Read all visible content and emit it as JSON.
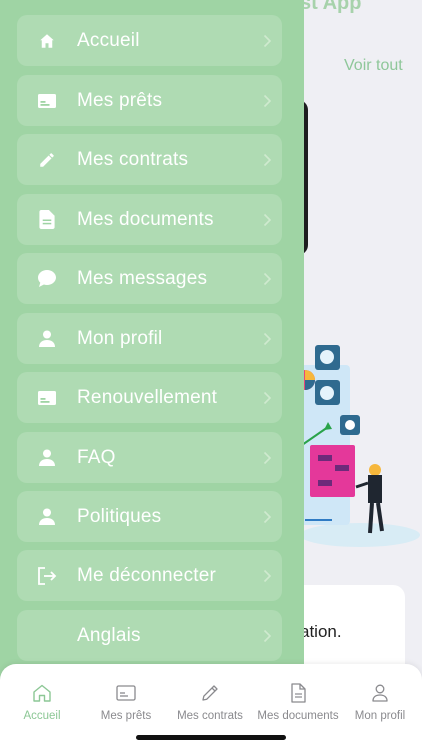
{
  "background": {
    "title_fragment": "st App",
    "voir_tout": "Voir tout",
    "panel_text": "ation."
  },
  "menu": {
    "items": [
      {
        "label": "Accueil",
        "icon": "home-icon"
      },
      {
        "label": "Mes prêts",
        "icon": "card-icon"
      },
      {
        "label": "Mes contrats",
        "icon": "pencil-icon"
      },
      {
        "label": "Mes documents",
        "icon": "document-icon"
      },
      {
        "label": "Mes messages",
        "icon": "chat-bubble-icon"
      },
      {
        "label": "Mon profil",
        "icon": "person-icon"
      },
      {
        "label": "Renouvellement",
        "icon": "card-icon"
      },
      {
        "label": "FAQ",
        "icon": "person-icon"
      },
      {
        "label": "Politiques",
        "icon": "person-icon"
      },
      {
        "label": "Me déconnecter",
        "icon": "logout-icon"
      },
      {
        "label": "Anglais",
        "icon": ""
      }
    ]
  },
  "tabbar": {
    "tabs": [
      {
        "label": "Accueil",
        "icon": "home-outline-icon",
        "active": true
      },
      {
        "label": "Mes prêts",
        "icon": "card-outline-icon",
        "active": false
      },
      {
        "label": "Mes contrats",
        "icon": "pencil-outline-icon",
        "active": false
      },
      {
        "label": "Mes documents",
        "icon": "document-outline-icon",
        "active": false
      },
      {
        "label": "Mon profil",
        "icon": "person-outline-icon",
        "active": false
      }
    ]
  },
  "colors": {
    "drawer_bg": "#9fd4a4",
    "accent": "#8cc795",
    "inactive": "#8a8a8e"
  }
}
